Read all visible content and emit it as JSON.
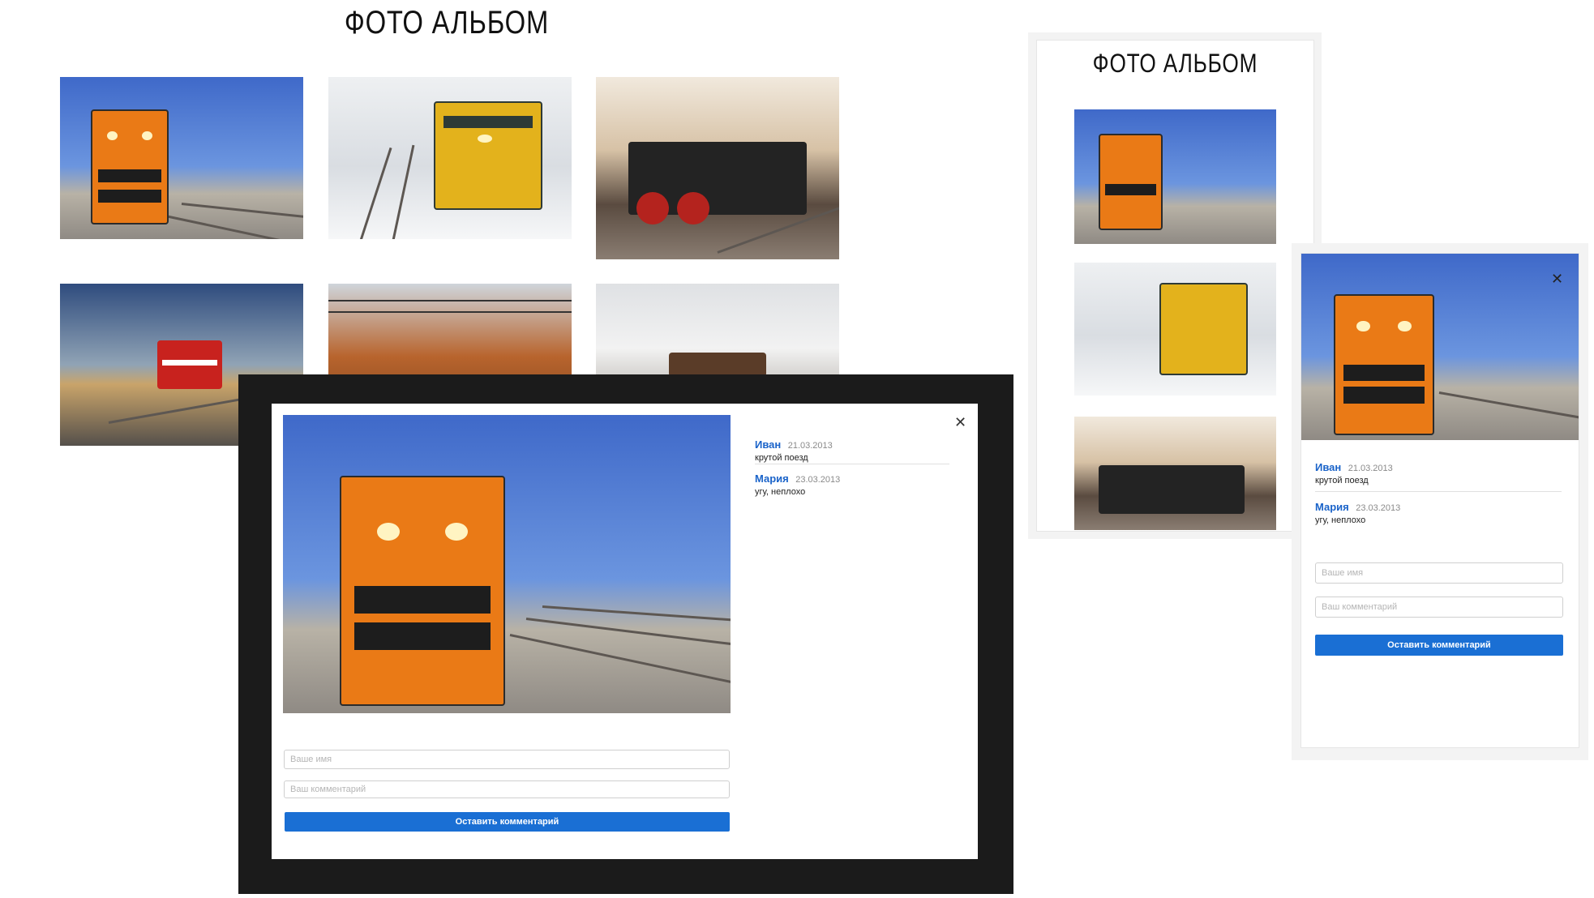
{
  "album": {
    "title": "ФОТО АЛЬБОМ"
  },
  "modal": {
    "close": "✕",
    "comments": [
      {
        "author": "Иван",
        "date": "21.03.2013",
        "text": "крутой поезд"
      },
      {
        "author": "Мария",
        "date": "23.03.2013",
        "text": "угу, неплохо"
      }
    ],
    "form": {
      "name_placeholder": "Ваше имя",
      "comment_placeholder": "Ваш комментарий",
      "submit_label": "Оставить комментарий"
    }
  },
  "mobile": {
    "title": "ФОТО АЛЬБОМ",
    "close": "✕"
  },
  "colors": {
    "accent": "#1a6fd4",
    "author": "#1a63c9",
    "overlay": "#1b1b1b"
  }
}
